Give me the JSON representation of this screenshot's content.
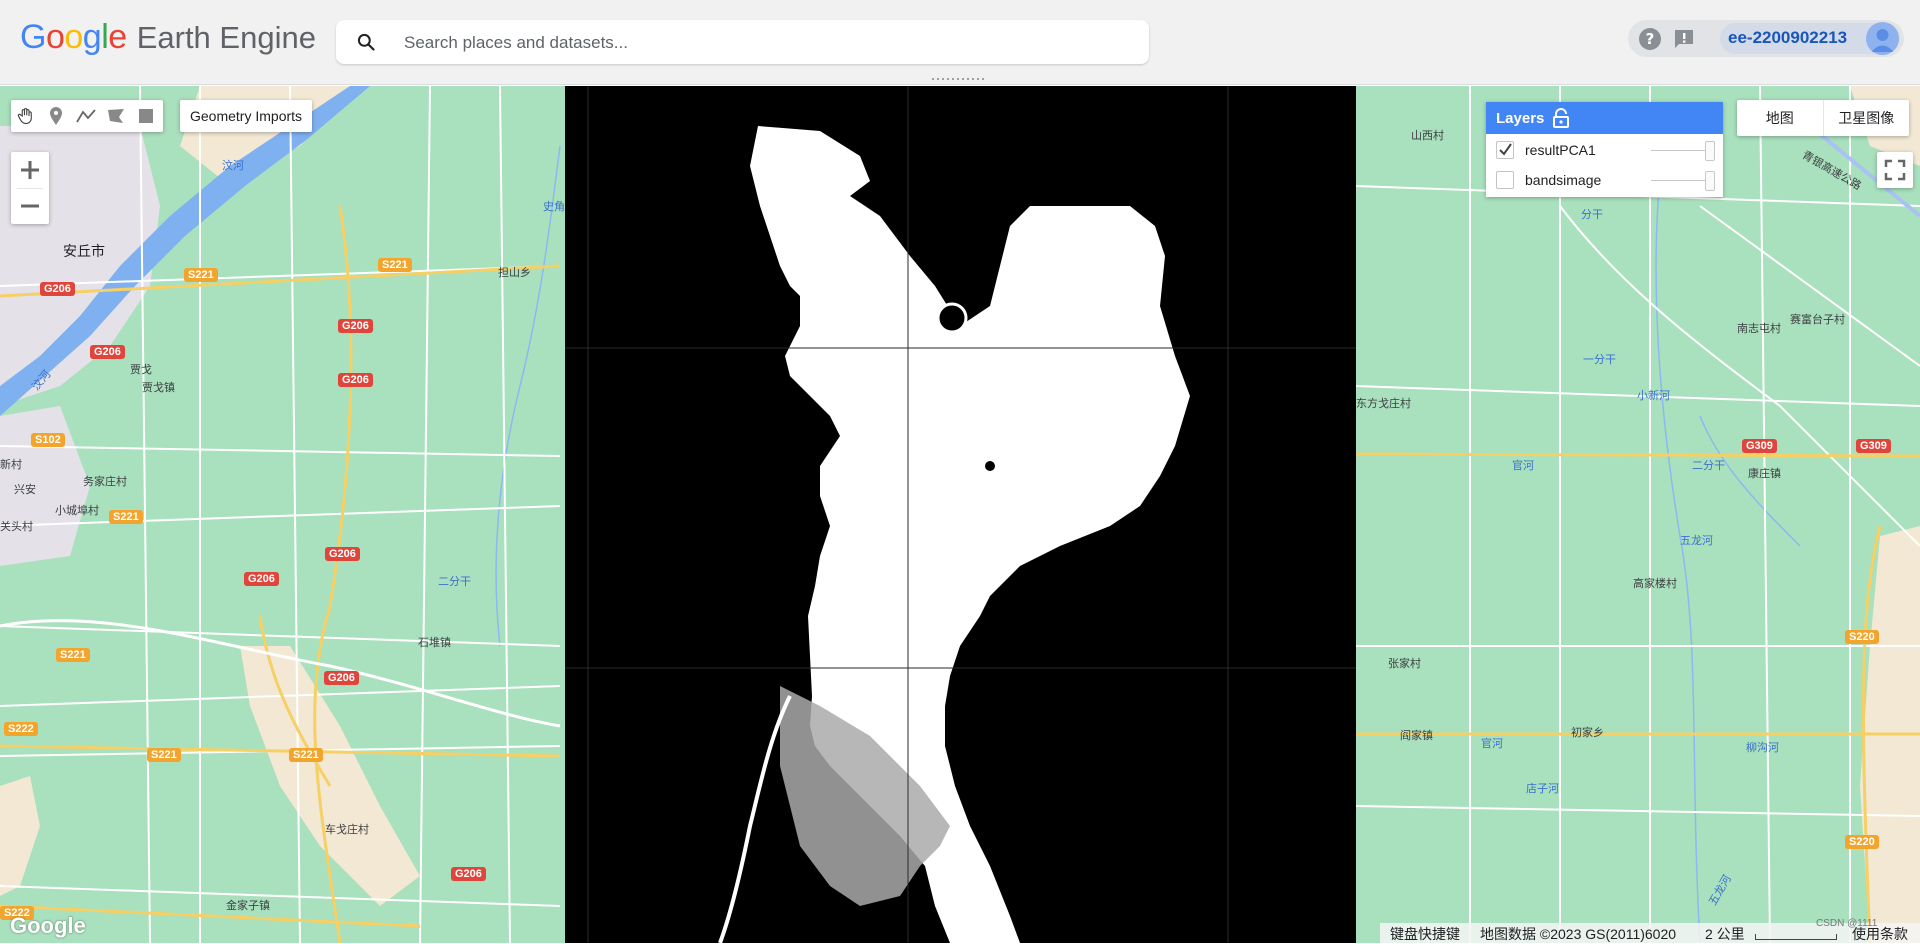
{
  "app": {
    "logo_google": "Google",
    "logo_product": "Earth Engine"
  },
  "search": {
    "placeholder": "Search places and datasets..."
  },
  "header": {
    "help_icon": "help-icon",
    "feedback_icon": "feedback-icon",
    "account": "ee-2200902213"
  },
  "toolbar": {
    "tools": [
      "hand-icon",
      "marker-icon",
      "line-icon",
      "polygon-icon",
      "rectangle-icon"
    ],
    "geometry_imports": "Geometry Imports"
  },
  "zoom": {
    "in": "+",
    "out": "−"
  },
  "layers": {
    "title": "Layers",
    "items": [
      {
        "name": "resultPCA1",
        "checked": true,
        "opacity": 1.0
      },
      {
        "name": "bandsimage",
        "checked": false,
        "opacity": 1.0
      }
    ]
  },
  "map_type": {
    "map": "地图",
    "satellite": "卫星图像"
  },
  "map_labels": {
    "cities": [
      "安丘市",
      "新村",
      "兴安",
      "关头村"
    ],
    "places_left": [
      "贾戈",
      "贾戈镇",
      "务家庄村",
      "小城埠村",
      "石堆镇",
      "车戈庄村",
      "金家子镇",
      "担山乡"
    ],
    "water_left": [
      "汶河",
      "汶河",
      "史角",
      "二分干"
    ],
    "places_right": [
      "山西村",
      "分干",
      "南志屯村",
      "赛富台子村",
      "一分干",
      "小新河",
      "东方戈庄村",
      "官河",
      "二分干",
      "康庄镇",
      "五龙河",
      "高家楼村",
      "张家村",
      "阎家镇",
      "官河",
      "初家乡",
      "柳沟河",
      "店子河",
      "五龙河",
      "青银高速公路"
    ],
    "roads": [
      "S221",
      "S221",
      "G206",
      "G206",
      "G206",
      "G206",
      "G206",
      "G206",
      "G206",
      "S102",
      "S221",
      "S221",
      "S221",
      "S221",
      "S222",
      "S222",
      "G206",
      "G309",
      "G309",
      "S220",
      "S220"
    ]
  },
  "footer": {
    "google": "Google",
    "shortcuts": "键盘快捷键",
    "attribution": "地图数据 ©2023 GS(2011)6020",
    "scale": "2 公里",
    "terms": "使用条款",
    "watermark": "CSDN @1111"
  },
  "colors": {
    "layers_header": "#4285f4",
    "map_green": "#a9e0bd",
    "road_red": "#e0453c",
    "road_orange": "#f2a42c",
    "account_text": "#1a56b8"
  }
}
